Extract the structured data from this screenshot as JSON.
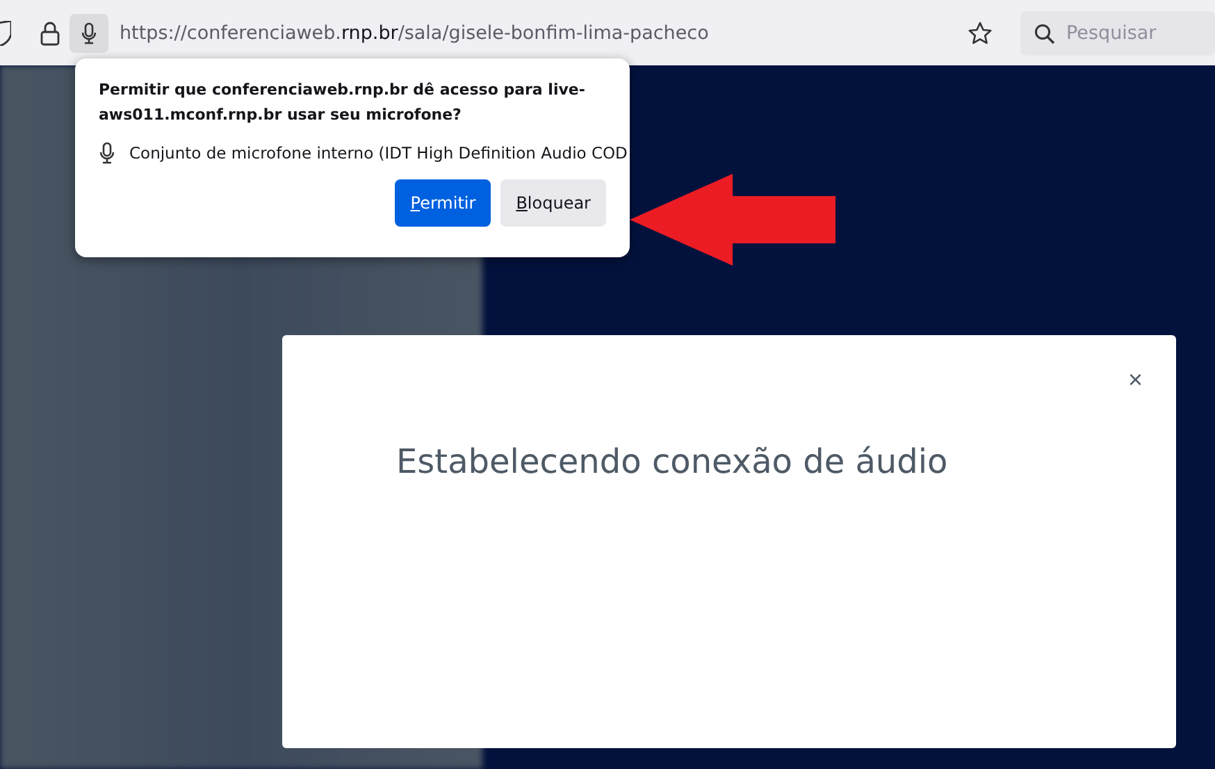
{
  "toolbar": {
    "url": {
      "prefix": "https://conferenciaweb.",
      "domain": "rnp.br",
      "path": "/sala/gisele-bonfim-lima-pacheco"
    },
    "search": {
      "placeholder": "Pesquisar"
    }
  },
  "permission_popup": {
    "question": "Permitir que conferenciaweb.rnp.br dê acesso para live-aws011.mconf.rnp.br usar seu microfone?",
    "device": "Conjunto de microfone interno (IDT High Definition Audio COD",
    "buttons": [
      {
        "kind": "primary",
        "key": "P",
        "rest": "ermitir"
      },
      {
        "kind": "secondary",
        "key": "B",
        "rest": "loquear"
      }
    ]
  },
  "annotation": {
    "kind": "arrow"
  },
  "modal": {
    "title": "Estabelecendo conexão de áudio",
    "close": "×"
  }
}
